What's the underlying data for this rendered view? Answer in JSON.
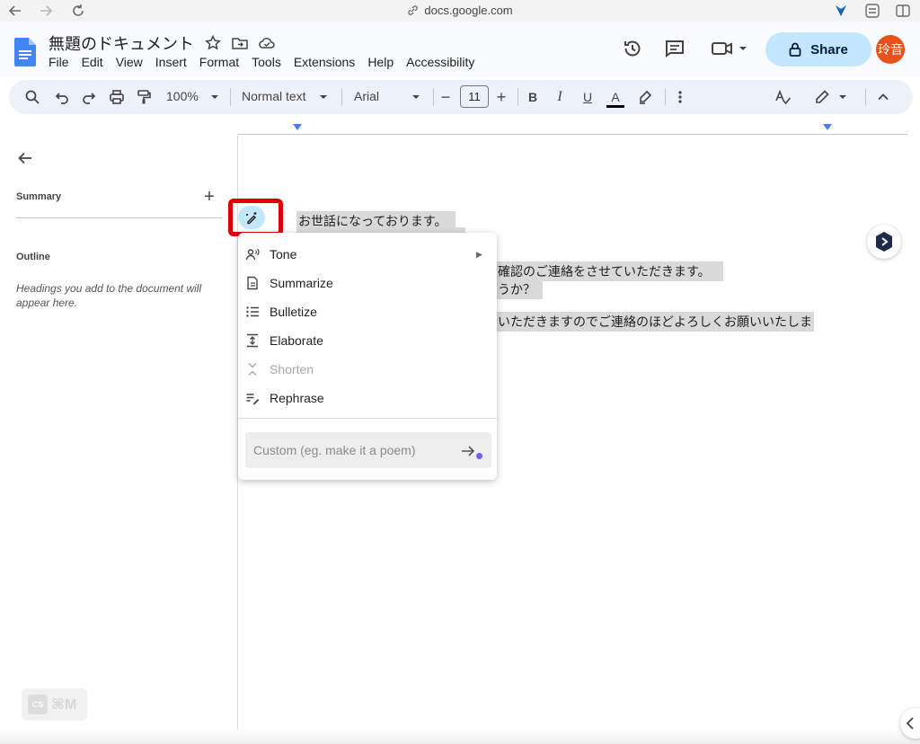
{
  "browser": {
    "url": "docs.google.com",
    "icons": [
      "back-icon",
      "forward-icon",
      "reload-icon",
      "link-icon",
      "extension-icon",
      "tab-settings-icon",
      "sidebar-icon"
    ]
  },
  "header": {
    "doc_title": "無題のドキュメント",
    "menu": [
      "File",
      "Edit",
      "View",
      "Insert",
      "Format",
      "Tools",
      "Extensions",
      "Help",
      "Accessibility"
    ],
    "share_label": "Share",
    "avatar_text": "玲音",
    "colors": {
      "share_bg": "#c2e7ff",
      "avatar_bg": "#e8501c",
      "header_bg": "#f9fbfd"
    }
  },
  "toolbar": {
    "zoom": "100%",
    "style": "Normal text",
    "font": "Arial",
    "font_size": "11",
    "minus": "−",
    "plus": "+",
    "bold": "B",
    "italic": "I",
    "underline": "U",
    "text_color": "A"
  },
  "sidebar": {
    "summary_label": "Summary",
    "summary_add": "+",
    "outline_label": "Outline",
    "outline_hint": "Headings you add to the document will appear here."
  },
  "document": {
    "lines": [
      "お世話になっております。",
      "確認のご連絡をさせていただきます。",
      "うか？",
      "いただきますのでご連絡のほどよろしくお願いいたしま"
    ]
  },
  "ai_menu": {
    "items": [
      {
        "label": "Tone",
        "icon": "voice-icon",
        "has_submenu": true
      },
      {
        "label": "Summarize",
        "icon": "document-icon"
      },
      {
        "label": "Bulletize",
        "icon": "bullet-list-icon"
      },
      {
        "label": "Elaborate",
        "icon": "expand-icon"
      },
      {
        "label": "Shorten",
        "icon": "collapse-icon",
        "disabled": true
      },
      {
        "label": "Rephrase",
        "icon": "rephrase-icon"
      }
    ],
    "custom_placeholder": "Custom (eg. make it a poem)",
    "submenu_arrow": "▶"
  },
  "floating": {
    "extension_badge_text": "⌘M",
    "extension_box_text": "CS"
  }
}
